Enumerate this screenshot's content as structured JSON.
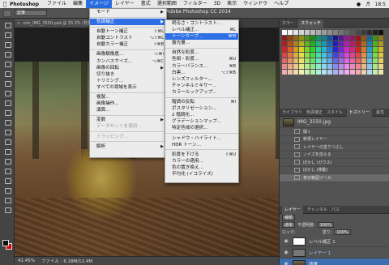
{
  "menubar": {
    "app_name": "Photoshop",
    "menus": [
      "ファイル",
      "編集",
      "イメージ",
      "レイヤー",
      "書式",
      "選択範囲",
      "フィルター",
      "3D",
      "表示",
      "ウィンドウ",
      "ヘルプ"
    ],
    "clock": "18:5"
  },
  "app_title": "Adobe Photoshop CC 2014",
  "options_bar": {
    "mode_select": "近筆"
  },
  "document_tab": {
    "title": "nim_IMG_3550.psd @ 33.3% (背景..."
  },
  "status_bar": {
    "zoom": "41.45%",
    "file_info": "ファイル : 6.18M/12.4M"
  },
  "image_menu": {
    "items": [
      {
        "label": "モード",
        "shortcut": "",
        "submenu": true
      },
      {
        "sep": true
      },
      {
        "label": "色調補正",
        "shortcut": "",
        "submenu": true,
        "highlight": true
      },
      {
        "sep": true
      },
      {
        "label": "自動トーン補正",
        "shortcut": "⇧⌘L"
      },
      {
        "label": "自動コントラスト",
        "shortcut": "⌥⇧⌘L"
      },
      {
        "label": "自動カラー補正",
        "shortcut": "⇧⌘B"
      },
      {
        "sep": true
      },
      {
        "label": "画像解像度...",
        "shortcut": "⌥⌘I"
      },
      {
        "label": "カンバスサイズ...",
        "shortcut": "⌥⌘C"
      },
      {
        "label": "画像の回転",
        "shortcut": "",
        "submenu": true
      },
      {
        "label": "切り抜き",
        "shortcut": ""
      },
      {
        "label": "トリミング...",
        "shortcut": ""
      },
      {
        "label": "すべての領域を表示",
        "shortcut": ""
      },
      {
        "sep": true
      },
      {
        "label": "複製...",
        "shortcut": ""
      },
      {
        "label": "画像操作...",
        "shortcut": ""
      },
      {
        "label": "演算...",
        "shortcut": ""
      },
      {
        "sep": true
      },
      {
        "label": "変数",
        "shortcut": "",
        "submenu": true
      },
      {
        "label": "データセットを適用...",
        "shortcut": "",
        "disabled": true
      },
      {
        "sep": true
      },
      {
        "label": "トラッピング...",
        "shortcut": "",
        "disabled": true
      },
      {
        "sep": true
      },
      {
        "label": "解析",
        "shortcut": "",
        "submenu": true
      }
    ]
  },
  "adjust_submenu": {
    "items": [
      {
        "label": "明るさ・コントラスト...",
        "shortcut": ""
      },
      {
        "label": "レベル補正...",
        "shortcut": "⌘L"
      },
      {
        "label": "トーンカーブ...",
        "shortcut": "⌘M",
        "highlight": true
      },
      {
        "label": "露光量...",
        "shortcut": ""
      },
      {
        "sep": true
      },
      {
        "label": "自然な彩度...",
        "shortcut": ""
      },
      {
        "label": "色相・彩度...",
        "shortcut": "⌘U"
      },
      {
        "label": "カラーバランス...",
        "shortcut": "⌘B"
      },
      {
        "label": "白黒...",
        "shortcut": "⌥⇧⌘B"
      },
      {
        "label": "レンズフィルター...",
        "shortcut": ""
      },
      {
        "label": "チャンネルミキサー...",
        "shortcut": ""
      },
      {
        "label": "カラールックアップ...",
        "shortcut": ""
      },
      {
        "sep": true
      },
      {
        "label": "階調の反転",
        "shortcut": "⌘I"
      },
      {
        "label": "ポスタリゼーション...",
        "shortcut": ""
      },
      {
        "label": "2 階調化...",
        "shortcut": ""
      },
      {
        "label": "グラデーションマップ...",
        "shortcut": ""
      },
      {
        "label": "特定色域の選択...",
        "shortcut": ""
      },
      {
        "sep": true
      },
      {
        "label": "シャドウ・ハイライト...",
        "shortcut": ""
      },
      {
        "label": "HDR トーン...",
        "shortcut": ""
      },
      {
        "sep": true
      },
      {
        "label": "彩度を下げる",
        "shortcut": "⇧⌘U"
      },
      {
        "label": "カラーの適用...",
        "shortcut": ""
      },
      {
        "label": "色の置き換え...",
        "shortcut": ""
      },
      {
        "label": "平均化 (イコライズ)",
        "shortcut": ""
      }
    ]
  },
  "panels": {
    "color_tabs": [
      "カラー",
      "スウォッチ"
    ],
    "history_tabs": [
      "ライブラリ",
      "色調補正",
      "スタイル",
      "ヒストリー",
      "属性"
    ],
    "history_file": "IMG_3550.jpg",
    "history_items": [
      "開く",
      "新規レイヤー",
      "レイヤーの塗りつぶし",
      "ノイズを加える",
      "ぼかし (ガウス)",
      "ぼかし (移動)",
      "表示範囲ツール"
    ],
    "layers_tabs": [
      "レイヤー",
      "チャンネル",
      "パス"
    ],
    "layers_kind": "種類",
    "blend_mode": "通常",
    "opacity_label": "不透明度:",
    "opacity_value": "100%",
    "lock_label": "ロック:",
    "fill_label": "塗り:",
    "fill_value": "100%",
    "layers": [
      {
        "name": "レベル補正 1"
      },
      {
        "name": "レイヤー 1"
      },
      {
        "name": "背景"
      }
    ]
  }
}
